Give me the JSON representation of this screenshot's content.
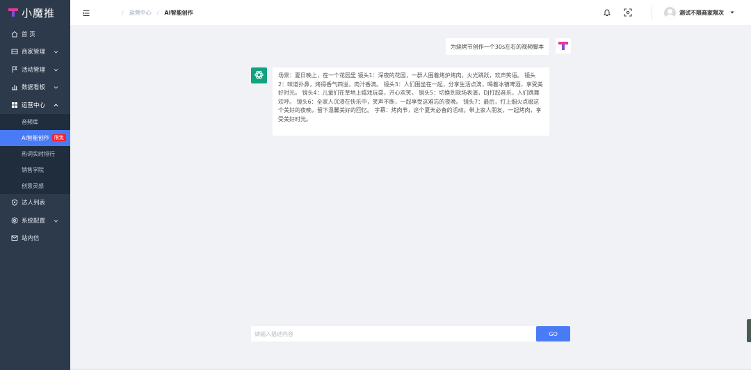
{
  "brand": {
    "name": "小魔推"
  },
  "colors": {
    "sidebar_bg": "#2d3a4b",
    "accent": "#4a7bf7",
    "badge": "#f5222d",
    "ai_avatar": "#10a37f"
  },
  "sidebar": {
    "items": [
      {
        "label": "首 页",
        "icon": "home-icon"
      },
      {
        "label": "商家管理",
        "icon": "store-icon"
      },
      {
        "label": "活动管理",
        "icon": "flag-icon"
      },
      {
        "label": "数据看板",
        "icon": "bar-chart-icon"
      },
      {
        "label": "运营中心",
        "icon": "grid-icon"
      },
      {
        "label": "达人列表",
        "icon": "shield-icon"
      },
      {
        "label": "系统配置",
        "icon": "settings-icon"
      },
      {
        "label": "站内信",
        "icon": "mail-icon"
      }
    ],
    "sub_items": [
      {
        "label": "音频库"
      },
      {
        "label": "AI智能创作",
        "badge": "限免"
      },
      {
        "label": "热词实时排行"
      },
      {
        "label": "销售学院"
      },
      {
        "label": "创意灵感"
      }
    ]
  },
  "header": {
    "breadcrumb": [
      "运营中心",
      "AI智能创作"
    ],
    "username": "测试不限商家限次"
  },
  "chat": {
    "user_message": "为烧烤节创作一个30s左右的视频脚本",
    "ai_message": "场景：夏日晚上，在一个花园里 镜头1：深夜的花园，一群人围着烤炉烤肉，火光跳跃，欢声笑语。 镜头2：味道扑鼻，烤得香气四溢，肉汁香滴。 镜头3：人们围坐在一起，分享生活点滴，喝着冰镇啤酒，享受美好时光。 镜头4：儿童们在草地上嬉戏玩耍，开心欢笑。 镜头5：切换到现场表演，DJ打起音乐，人们跳舞欢呼。 镜头6：全家人沉浸在快乐中，笑声不断，一起享受这难忘的夜晚。 镜头7：最后，打上烟火点缀这个美好的夜晚，留下温馨美好的回忆。 字幕：烤肉节，这个夏天必备的活动。带上家人朋友，一起烤肉，享受美好时光。",
    "input_placeholder": "请输入描述内容",
    "input_value": "",
    "go_label": "GO"
  }
}
